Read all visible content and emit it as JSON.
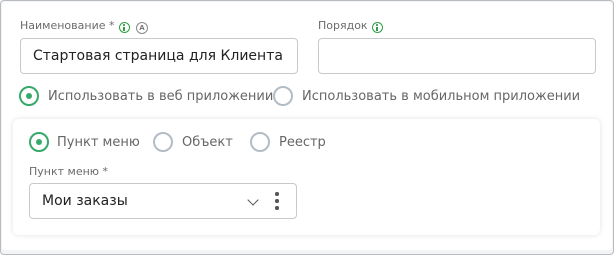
{
  "form": {
    "name_label": "Наименование *",
    "name_value": "Стартовая страница для Клиента",
    "order_label": "Порядок",
    "order_value": "",
    "a_badge": "A",
    "platform_options": [
      {
        "label": "Использовать в веб приложении",
        "checked": true
      },
      {
        "label": "Использовать в мобильном приложении",
        "checked": false
      }
    ]
  },
  "panel": {
    "type_options": [
      {
        "label": "Пункт меню",
        "checked": true
      },
      {
        "label": "Объект",
        "checked": false
      },
      {
        "label": "Реестр",
        "checked": false
      }
    ],
    "menu_item_label": "Пункт меню *",
    "menu_item_value": "Мои заказы"
  },
  "icons": {
    "info": "info-icon",
    "auto": "auto-a-icon",
    "dropdown": "chevron-down-icon",
    "more": "kebab-menu-icon"
  },
  "colors": {
    "accent": "#36a96b",
    "info_green": "#2f9e44",
    "border": "#c7c9cc"
  }
}
